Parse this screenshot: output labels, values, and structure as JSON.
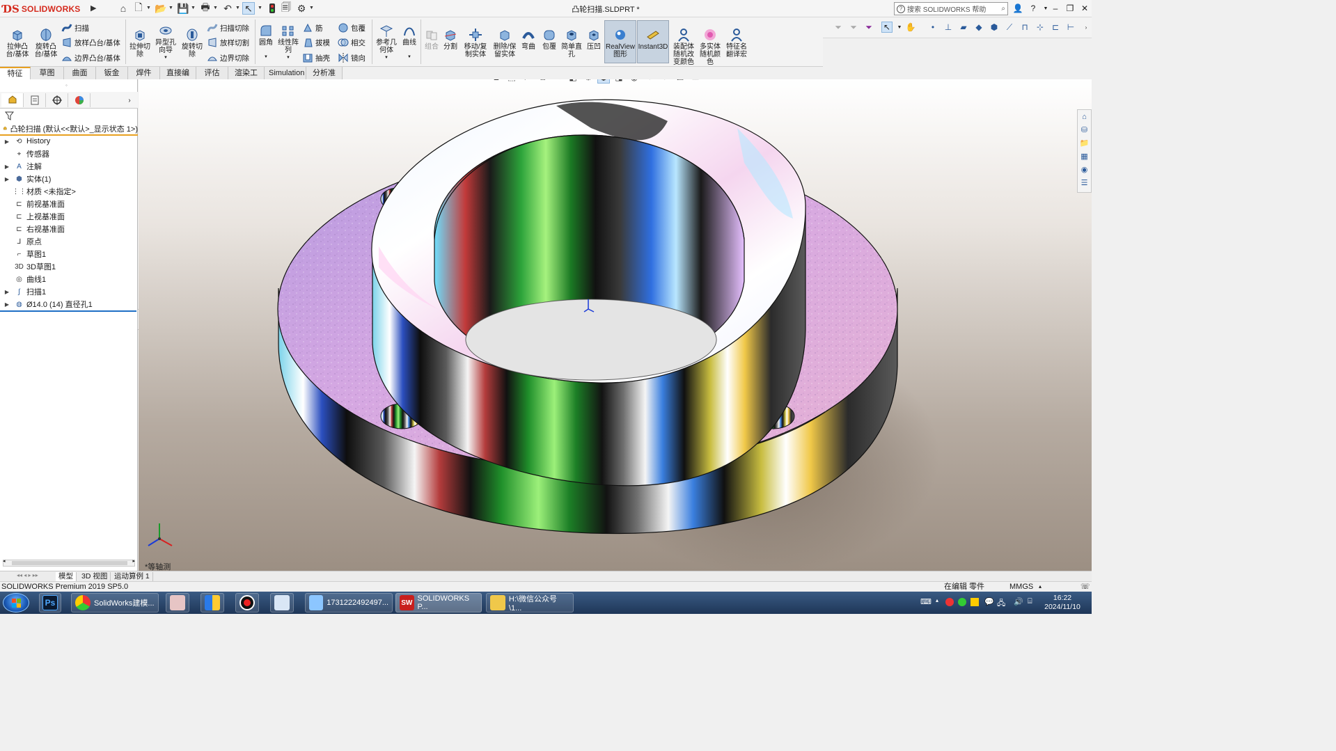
{
  "app": {
    "brand": "SOLIDWORKS",
    "document_title": "凸轮扫描.SLDPRT *",
    "search_placeholder": "搜索 SOLIDWORKS 帮助"
  },
  "commands": {
    "extrude_boss": "拉伸凸\n台/基体",
    "revolve_boss": "旋转凸\n台/基体",
    "sweep": "扫描",
    "loft": "放样凸台/基体",
    "boundary": "边界凸台/基体",
    "extrude_cut": "拉伸切\n除",
    "hole_wizard": "异型孔\n向导",
    "revolve_cut": "旋转切\n除",
    "swept_cut": "扫描切除",
    "lofted_cut": "放样切割",
    "boundary_cut": "边界切除",
    "fillet": "圆角",
    "linear_pattern": "线性阵\n列",
    "rib": "筋",
    "draft": "拔模",
    "shell": "抽壳",
    "wrap": "包覆",
    "intersect": "相交",
    "mirror": "镜向",
    "ref_geometry": "参考几\n何体",
    "curves": "曲线",
    "combine": "组合",
    "split": "分割",
    "move_copy": "移动/复\n制实体",
    "delete_keep": "删除/保\n留实体",
    "flex": "弯曲",
    "wrap2": "包覆",
    "simple_hole": "简单直\n孔",
    "indent": "压凹",
    "realview": "RealView\n图形",
    "instant3d": "Instant3D",
    "asm_random_color": "装配体\n随机改\n变颜色",
    "multibody_random_color": "多实体\n随机颜\n色",
    "feature_translate": "特征名\n翻译宏"
  },
  "tabs": [
    "特征",
    "草图",
    "曲面",
    "钣金",
    "焊件",
    "直接编辑",
    "评估",
    "渲染工具",
    "Simulation",
    "分析准备"
  ],
  "active_tab": "特征",
  "tree": {
    "root": "凸轮扫描  (默认<<默认>_显示状态 1>)",
    "items": [
      {
        "label": "History",
        "expandable": true,
        "icon": "history-icon"
      },
      {
        "label": "传感器",
        "expandable": false,
        "icon": "sensor-icon"
      },
      {
        "label": "注解",
        "expandable": true,
        "icon": "annotation-icon"
      },
      {
        "label": "实体(1)",
        "expandable": true,
        "icon": "solid-body-icon"
      },
      {
        "label": "材质 <未指定>",
        "expandable": false,
        "icon": "material-icon"
      },
      {
        "label": "前视基准面",
        "expandable": false,
        "icon": "plane-icon"
      },
      {
        "label": "上视基准面",
        "expandable": false,
        "icon": "plane-icon"
      },
      {
        "label": "右视基准面",
        "expandable": false,
        "icon": "plane-icon"
      },
      {
        "label": "原点",
        "expandable": false,
        "icon": "origin-icon"
      },
      {
        "label": "草图1",
        "expandable": false,
        "icon": "sketch-icon"
      },
      {
        "label": "3D草图1",
        "expandable": false,
        "icon": "3d-sketch-icon"
      },
      {
        "label": "曲线1",
        "expandable": false,
        "icon": "curve-icon"
      },
      {
        "label": "扫描1",
        "expandable": true,
        "icon": "sweep-icon"
      },
      {
        "label": "Ø14.0 (14) 直径孔1",
        "expandable": true,
        "icon": "hole-icon"
      }
    ]
  },
  "viewport": {
    "view_label": "*等轴测"
  },
  "bottom_tabs": [
    "模型",
    "3D 视图",
    "运动算例 1"
  ],
  "status": {
    "product": "SOLIDWORKS Premium 2019 SP5.0",
    "mode": "在编辑 零件",
    "units": "MMGS"
  },
  "taskbar": {
    "items": [
      {
        "label": "SolidWorks建模...",
        "icon": "chrome-icon"
      },
      {
        "label": "1731222492497...",
        "icon": "image-viewer-icon"
      },
      {
        "label": "SOLIDWORKS P...",
        "icon": "solidworks-icon"
      },
      {
        "label": "H:\\微信公众号\\1...",
        "icon": "folder-icon"
      }
    ],
    "clock_time": "16:22",
    "clock_date": "2024/11/10"
  }
}
